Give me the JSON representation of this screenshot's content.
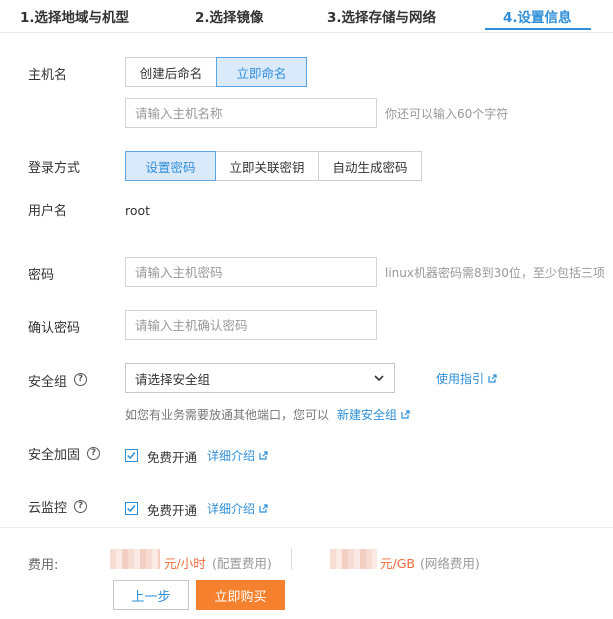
{
  "tabs": [
    {
      "label": "1.选择地域与机型",
      "active": false
    },
    {
      "label": "2.选择镜像",
      "active": false
    },
    {
      "label": "3.选择存储与网络",
      "active": false
    },
    {
      "label": "4.设置信息",
      "active": true
    }
  ],
  "hostname": {
    "label": "主机名",
    "options": [
      {
        "label": "创建后命名",
        "active": false
      },
      {
        "label": "立即命名",
        "active": true
      }
    ],
    "input_placeholder": "请输入主机名称",
    "hint": "你还可以输入60个字符"
  },
  "login": {
    "label": "登录方式",
    "options": [
      {
        "label": "设置密码",
        "active": true
      },
      {
        "label": "立即关联密钥",
        "active": false
      },
      {
        "label": "自动生成密码",
        "active": false
      }
    ]
  },
  "username": {
    "label": "用户名",
    "value": "root"
  },
  "password": {
    "label": "密码",
    "input_placeholder": "请输入主机密码",
    "hint": "linux机器密码需8到30位，至少包括三项"
  },
  "confirm_password": {
    "label": "确认密码",
    "input_placeholder": "请输入主机确认密码"
  },
  "security_group": {
    "label": "安全组",
    "select_value": "请选择安全组",
    "guide_link": "使用指引",
    "note": "如您有业务需要放通其他端口，您可以",
    "new_link": "新建安全组"
  },
  "hardening": {
    "label": "安全加固",
    "checkbox_label": "免费开通",
    "checked": true,
    "detail_link": "详细介绍"
  },
  "monitor": {
    "label": "云监控",
    "checkbox_label": "免费开通",
    "checked": true,
    "detail_link": "详细介绍"
  },
  "footer": {
    "fee_label": "费用:",
    "unit1": "元/小时",
    "note1": "(配置费用)",
    "unit2": "元/GB",
    "note2": "(网络费用)",
    "prev_button": "上一步",
    "buy_button": "立即购买"
  },
  "colors": {
    "accent": "#2f8fd8",
    "buy": "#f5802e",
    "price": "#f06c3c"
  }
}
